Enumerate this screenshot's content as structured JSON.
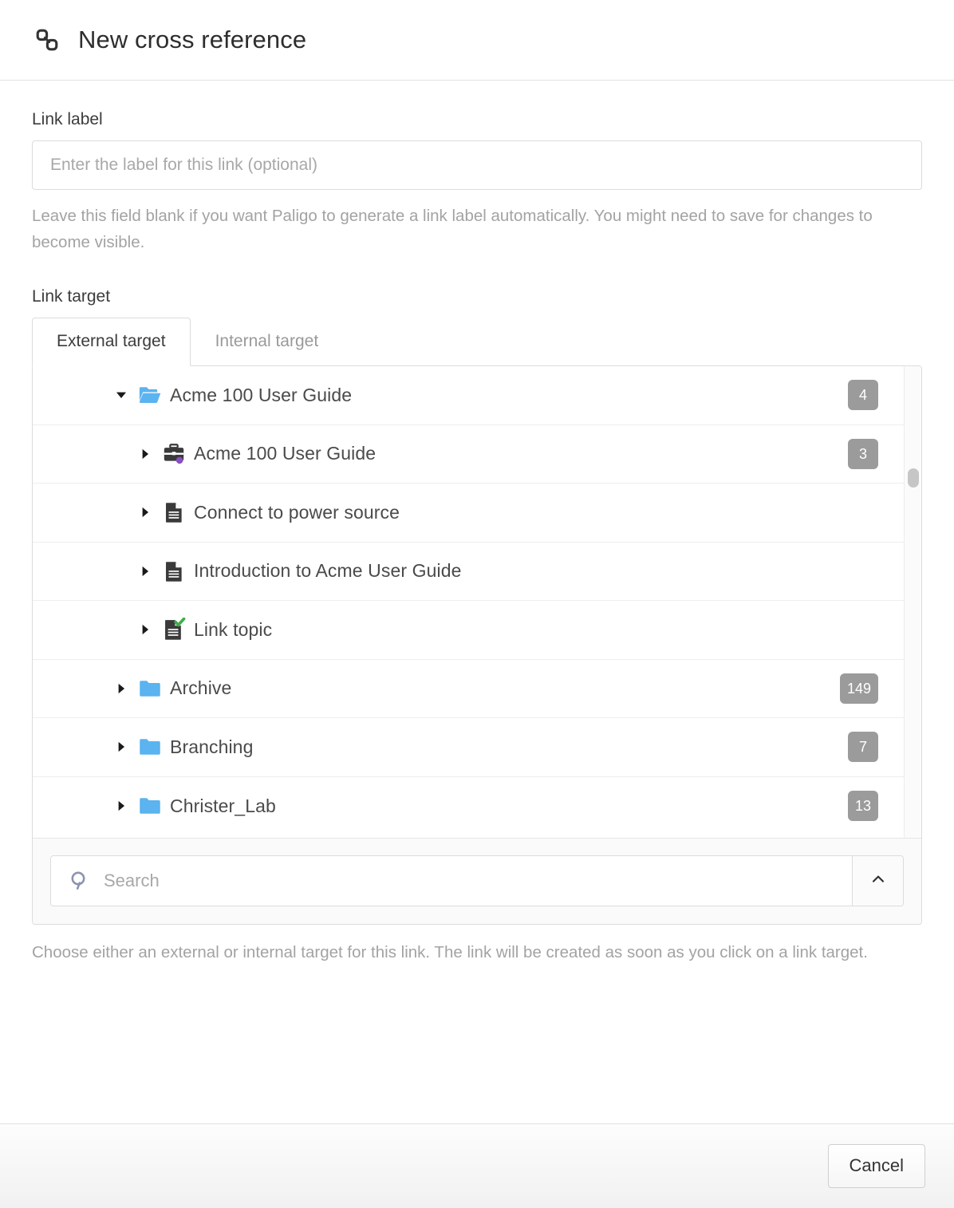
{
  "header": {
    "icon": "chain-link-icon",
    "title": "New cross reference"
  },
  "link_label": {
    "label": "Link label",
    "value": "",
    "placeholder": "Enter the label for this link (optional)",
    "helper": "Leave this field blank if you want Paligo to generate a link label automatically. You might need to save for changes to become visible."
  },
  "link_target": {
    "label": "Link target",
    "tabs": [
      {
        "label": "External target",
        "active": true
      },
      {
        "label": "Internal target",
        "active": false
      }
    ],
    "tree": [
      {
        "label": "Acme 100 User Guide",
        "icon": "folder-open-icon",
        "twisty": "caret-down-icon",
        "expanded": true,
        "depth": 0,
        "badge": "4"
      },
      {
        "label": "Acme 100 User Guide",
        "icon": "publication-briefcase-icon",
        "twisty": "caret-right-icon",
        "expanded": false,
        "depth": 1,
        "badge": "3"
      },
      {
        "label": "Connect to power source",
        "icon": "document-icon",
        "twisty": "caret-right-icon",
        "expanded": false,
        "depth": 1,
        "badge": ""
      },
      {
        "label": "Introduction to Acme User Guide",
        "icon": "document-icon",
        "twisty": "caret-right-icon",
        "expanded": false,
        "depth": 1,
        "badge": ""
      },
      {
        "label": "Link topic",
        "icon": "document-check-icon",
        "twisty": "caret-right-icon",
        "expanded": false,
        "depth": 1,
        "badge": ""
      },
      {
        "label": "Archive",
        "icon": "folder-icon",
        "twisty": "caret-right-icon",
        "expanded": false,
        "depth": 0,
        "badge": "149"
      },
      {
        "label": "Branching",
        "icon": "folder-icon",
        "twisty": "caret-right-icon",
        "expanded": false,
        "depth": 0,
        "badge": "7"
      },
      {
        "label": "Christer_Lab",
        "icon": "folder-icon",
        "twisty": "caret-right-icon",
        "expanded": false,
        "depth": 0,
        "badge": "13"
      }
    ],
    "search": {
      "value": "",
      "placeholder": "Search",
      "icon": "search-icon",
      "collapse_icon": "chevron-up-icon"
    },
    "helper": "Choose either an external or internal target for this link. The link will be created as soon as you click on a link target."
  },
  "footer": {
    "cancel_label": "Cancel"
  },
  "colors": {
    "folder_blue": "#5bb3f0",
    "badge_gray": "#9b9b9b",
    "check_green": "#3fae49",
    "publication_dot_purple": "#8a4fc4",
    "document_dark": "#3a3a3a",
    "search_icon": "#8c93b3"
  }
}
